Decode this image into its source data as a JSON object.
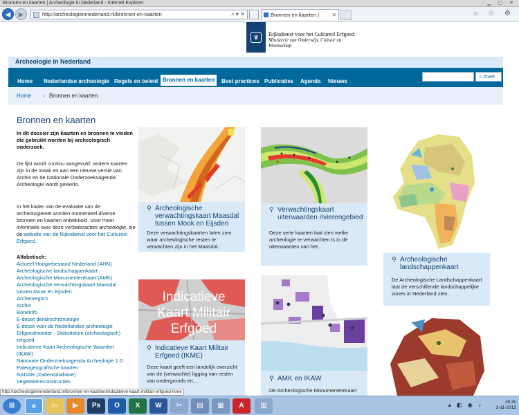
{
  "browser": {
    "window_title": "Bronnen en kaarten | Archeologie in Nederland - Internet Explorer",
    "address": "http://archeologieinnederland.nl/bronnen-en-kaarten",
    "tab_title": "Bronnen en kaarten | Archeo...",
    "status_url": "http://archeologieinnederland.nl/bronnen-en-kaarten/indicatieve-kaart-militair-erfgoed-ikme"
  },
  "header": {
    "org_line1": "Rijksdienst voor het Cultureel Erfgoed",
    "org_line2": "Ministerie van Onderwijs, Cultuur en",
    "org_line3": "Wetenschap",
    "site_name": "Archeologie in Nederland"
  },
  "nav": {
    "items": [
      "Home",
      "Nederlandse archeologie",
      "Regels en beleid",
      "Bronnen en kaarten",
      "Best practices",
      "Publicaties",
      "Agenda",
      "Nieuws"
    ],
    "search_button": "Zoek"
  },
  "breadcrumb": {
    "home": "Home",
    "current": "Bronnen en kaarten"
  },
  "main": {
    "title": "Bronnen en kaarten",
    "intro": "In dit dossier zijn kaarten en bronnen te vinden die gebruikt worden bij archeologisch onderzoek.",
    "p1": "De lijst wordt continu aangevuld: andere kaarten zijn in de maak en aan een nieuwe versie van Archis en de Nationale Onderzoeksagenda Archeologie wordt gewerkt.",
    "p2_a": "In het kader van de evaluatie van de archeologiewet worden momenteel diverse bronnen en kaarten ontwikkeld. Voor meer informatie over deze ",
    "p2_italic": "verbeteracties archeologie",
    "p2_b": ", zie de ",
    "p2_link": "website van de Rijksdienst voor het Cultureel Erfgoed",
    "p2_c": ".",
    "alfa_title": "Alfabetisch:",
    "alfa": [
      "Actueel Hoogtebestand Nederland (AHN)",
      "Archeologische landschappenkaart",
      "Archeologische MonumentenKaart (AMK)",
      "Archeologische verwachtingskaart Maasdal",
      "tussen Mook en Eijsden",
      "Archeoregio's",
      "Archis",
      "BoneInfo",
      "E-depot dendrochronologie",
      "E-depot voor de Nederlandse archeologie",
      "Erfgoedmonitor - Statistieken (archeologisch)",
      "erfgoed",
      "Indicatieve Kaart Archeologische Waarden",
      "(IKAW)",
      "Nationale Onderzoeksagenda Archeologie 1.0",
      "Paleogeografische kaarten",
      "RADAR (Zadendatabase)",
      "Vegetatiereconstructies"
    ]
  },
  "cards": [
    {
      "title": "Archeologische verwachtingskaart Maasdal tussen Mook en Eijsden",
      "desc": "Deze verwachtingskaarten laten zien waar archeologische resten te verwachten zijn in het Maasdal."
    },
    {
      "title": "Verwachtingskaart uiterwaarden rivierengebied",
      "desc": "Deze serie kaarten laat zien welke archeologie te verwachten is in de uiterwaarden van het..."
    },
    {
      "title": "Archeologische landschappenkaart",
      "desc": "De Archeologische Landschappenkaart laat de verschillende landschappelijke zones in Nederland zien."
    },
    {
      "title": "Indicatieve Kaart Militair Erfgoed (IKME)",
      "desc": "Deze kaart geeft een landelijk overzicht van de (verwachte) ligging van resten van ondergronds en...",
      "image_text": "Indicatieve Kaart Militair Erfgoed"
    },
    {
      "title": "AMK en IKAW",
      "desc": "De Archeologische MonumentenKaart"
    }
  ],
  "taskbar": {
    "time": "15:30",
    "date": "3-11-2015"
  },
  "colors": {
    "brand": "#01689b",
    "dark_blue": "#154273",
    "light_blue": "#d9e9f7"
  }
}
